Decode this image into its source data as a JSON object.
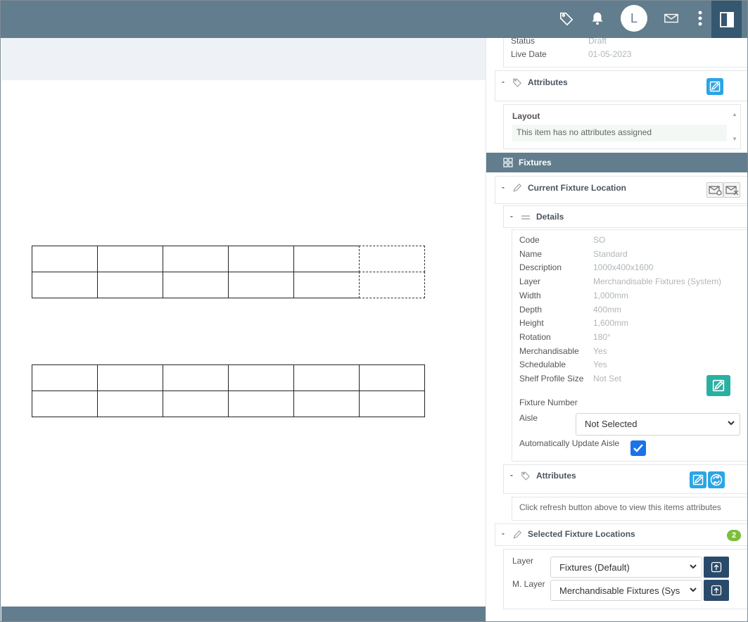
{
  "topbar": {
    "avatar_initial": "L"
  },
  "panel": {
    "summary": {
      "status_label": "Status",
      "status_value": "Draft",
      "live_date_label": "Live Date",
      "live_date_value": "01-05-2023"
    },
    "attributes_top": {
      "title": "Attributes",
      "layout_label": "Layout",
      "no_attributes": "This item has no attributes assigned"
    },
    "fixtures_section": {
      "title": "Fixtures"
    },
    "current_fixture": {
      "title": "Current Fixture Location",
      "details_title": "Details",
      "details": [
        {
          "label": "Code",
          "value": "SO"
        },
        {
          "label": "Name",
          "value": "Standard"
        },
        {
          "label": "Description",
          "value": "1000x400x1600"
        },
        {
          "label": "Layer",
          "value": "Merchandisable Fixtures (System)"
        },
        {
          "label": "Width",
          "value": "1,000mm"
        },
        {
          "label": "Depth",
          "value": "400mm"
        },
        {
          "label": "Height",
          "value": "1,600mm"
        },
        {
          "label": "Rotation",
          "value": "180°"
        },
        {
          "label": "Merchandisable",
          "value": "Yes"
        },
        {
          "label": "Schedulable",
          "value": "Yes"
        },
        {
          "label": "Shelf Profile Size",
          "value": "Not Set"
        }
      ],
      "fixture_number_label": "Fixture Number",
      "aisle_label": "Aisle",
      "aisle_value": "Not Selected",
      "auto_update_label": "Automatically Update Aisle",
      "auto_update_checked": true,
      "attributes_title": "Attributes",
      "refresh_hint": "Click refresh button above to view this items attributes"
    },
    "selected_fixtures": {
      "title": "Selected Fixture Locations",
      "count": "2",
      "layer_label": "Layer",
      "layer_value": "Fixtures (Default)",
      "m_layer_label": "M. Layer",
      "m_layer_value": "Merchandisable Fixtures (Sys"
    }
  },
  "colors": {
    "topbar": "#627d8d",
    "accent_blue": "#2aa5e6",
    "accent_teal": "#2ab0a0",
    "navy": "#2a4a6a",
    "badge_green": "#7bbf3a"
  },
  "icons": [
    "tag-icon",
    "bell-icon",
    "mail-icon",
    "more-vertical-icon",
    "panel-toggle-icon",
    "edit-icon",
    "pencil-icon",
    "grid-icon",
    "refresh-icon",
    "upload-icon"
  ]
}
